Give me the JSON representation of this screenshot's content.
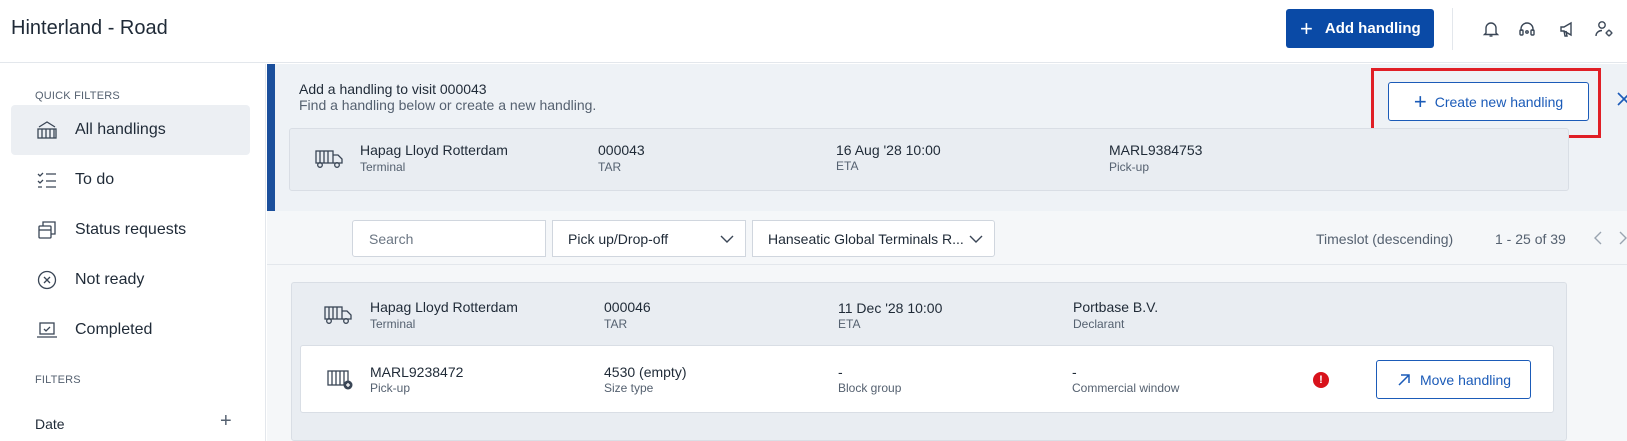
{
  "app": {
    "title": "Hinterland - Road"
  },
  "header": {
    "add_handling_label": "Add handling",
    "icons": [
      "bell-icon",
      "headset-icon",
      "megaphone-icon",
      "user-settings-icon"
    ]
  },
  "sidebar": {
    "quick_filters_label": "QUICK FILTERS",
    "items": [
      {
        "label": "All handlings",
        "icon": "crane-icon",
        "active": true
      },
      {
        "label": "To do",
        "icon": "checklist-icon",
        "active": false
      },
      {
        "label": "Status requests",
        "icon": "copy-icon",
        "active": false
      },
      {
        "label": "Not ready",
        "icon": "x-circle-icon",
        "active": false
      },
      {
        "label": "Completed",
        "icon": "laptop-check-icon",
        "active": false
      }
    ],
    "filters_label": "FILTERS",
    "date_filter_label": "Date"
  },
  "banner": {
    "title": "Add a handling to visit 000043",
    "subtitle": "Find a handling below or create a new handling.",
    "create_button_label": "Create new handling",
    "visit": {
      "terminal": "Hapag Lloyd Rotterdam",
      "terminal_sub": "Terminal",
      "tar": "000043",
      "tar_sub": "TAR",
      "eta": "16 Aug '28 10:00",
      "eta_sub": "ETA",
      "container": "MARL9384753",
      "container_sub": "Pick-up"
    }
  },
  "toolbar": {
    "search_placeholder": "Search",
    "type_filter": "Pick up/Drop-off",
    "terminal_filter": "Hanseatic Global Terminals R...",
    "sort_label": "Timeslot (descending)",
    "pagination": "1 - 25 of 39"
  },
  "visit_card": {
    "terminal": "Hapag Lloyd Rotterdam",
    "terminal_sub": "Terminal",
    "tar": "000046",
    "tar_sub": "TAR",
    "eta": "11 Dec '28 10:00",
    "eta_sub": "ETA",
    "declarant": "Portbase B.V.",
    "declarant_sub": "Declarant"
  },
  "handling": {
    "container": "MARL9238472",
    "container_sub": "Pick-up",
    "size": "4530 (empty)",
    "size_sub": "Size type",
    "block": "-",
    "block_sub": "Block group",
    "window": "-",
    "window_sub": "Commercial window",
    "alert_mark": "!",
    "move_button_label": "Move handling"
  },
  "colors": {
    "brand": "#0a4aa6",
    "accent": "#1b5bb8",
    "highlight": "#e01f26",
    "alert": "#d8121b"
  }
}
